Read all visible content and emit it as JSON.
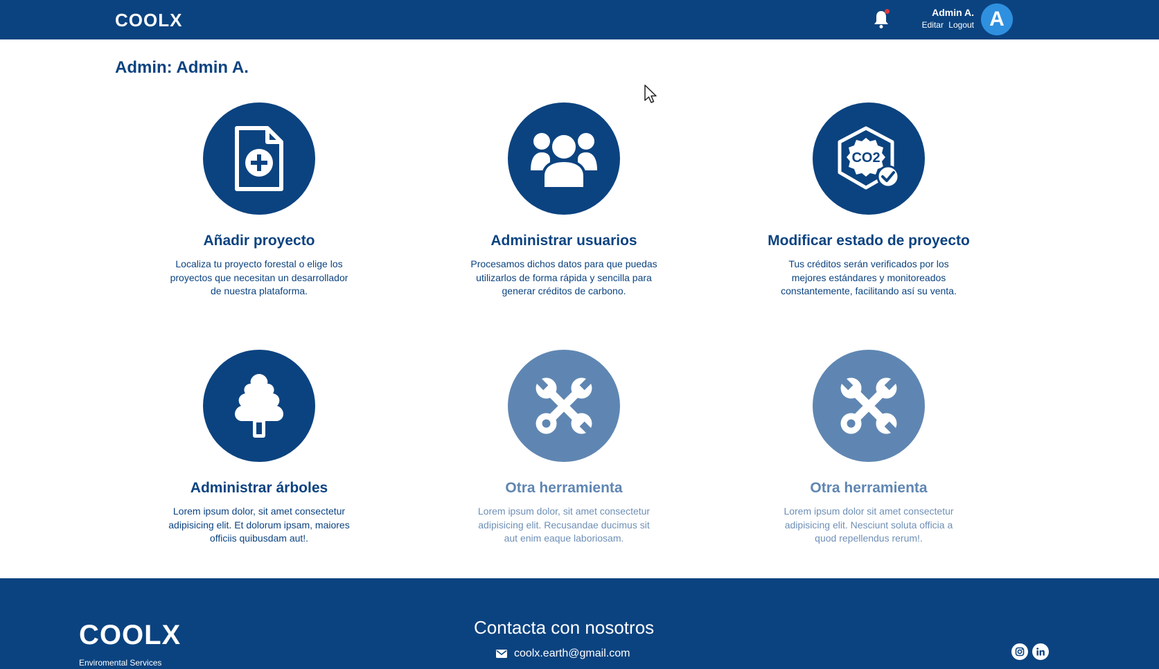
{
  "header": {
    "logo": "COOLX",
    "user_name": "Admin A.",
    "edit_label": "Editar",
    "logout_label": "Logout",
    "avatar_letter": "A"
  },
  "page": {
    "title": "Admin: Admin A."
  },
  "cards": [
    {
      "icon": "file-add-icon",
      "title": "Añadir proyecto",
      "description": "Localiza tu proyecto forestal o elige los proyectos que necesitan un desarrollador de nuestra plataforma."
    },
    {
      "icon": "users-icon",
      "title": "Administrar usuarios",
      "description": "Procesamos dichos datos para que puedas utilizarlos de forma rápida y sencilla para generar créditos de carbono."
    },
    {
      "icon": "co2-badge-icon",
      "title": "Modificar estado de proyecto",
      "description": "Tus créditos serán verificados por los mejores estándares y monitoreados constantemente, facilitando así su venta."
    },
    {
      "icon": "tree-icon",
      "title": "Administrar árboles",
      "description": "Lorem ipsum dolor, sit amet consectetur adipisicing elit. Et dolorum ipsam, maiores officiis quibusdam aut!."
    },
    {
      "icon": "tools-icon",
      "title": "Otra herramienta",
      "description": "Lorem ipsum dolor, sit amet consectetur adipisicing elit. Recusandae ducimus sit aut enim eaque laboriosam."
    },
    {
      "icon": "tools-icon",
      "title": "Otra herramienta",
      "description": "Lorem ipsum dolor sit amet consectetur adipisicing elit. Nesciunt soluta officia a quod repellendus rerum!."
    }
  ],
  "footer": {
    "logo": "COOLX",
    "tagline": "Enviromental Services",
    "heading": "Contacta con nosotros",
    "email": "coolx.earth@gmail.com"
  },
  "colors": {
    "primary": "#0b4380",
    "muted": "#5f86b2",
    "avatar": "#2f90e0",
    "notification": "#e0393e"
  }
}
